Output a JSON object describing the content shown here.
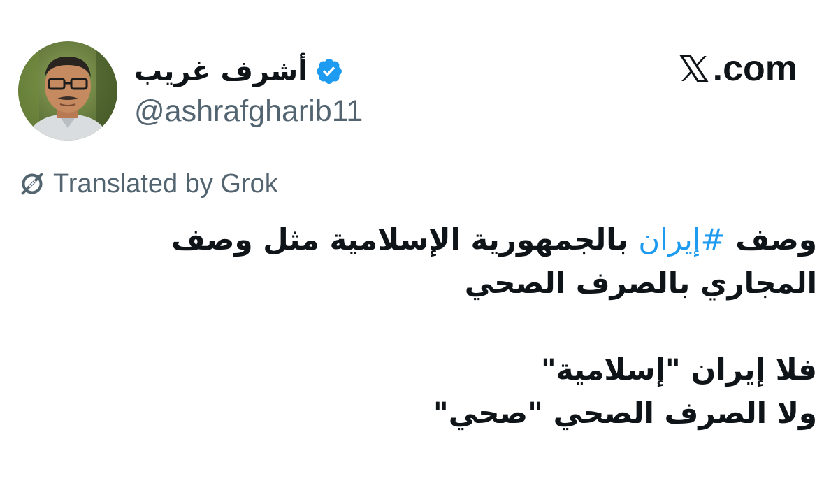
{
  "author": {
    "display_name": "أشرف غريب",
    "handle": "@ashrafgharib11",
    "verified": true,
    "verified_color": "#1d9bf0"
  },
  "site": {
    "name": ".com",
    "logo_icon": "x-logo-icon"
  },
  "translation": {
    "label": "Translated by Grok",
    "icon": "grok-icon"
  },
  "tweet": {
    "line1_before": "وصف ",
    "hashtag": "#إيران",
    "line1_after": " بالجمهورية الإسلامية مثل وصف",
    "line2": "المجاري بالصرف الصحي",
    "line3": "فلا إيران \"إسلامية\"",
    "line4": "ولا الصرف الصحي \"صحي\""
  },
  "colors": {
    "text": "#0f1419",
    "secondary": "#536471",
    "link": "#1d9bf0"
  }
}
